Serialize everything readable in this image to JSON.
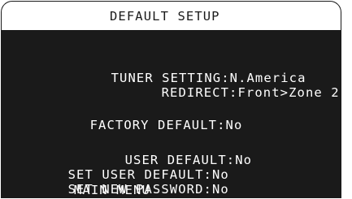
{
  "title": "DEFAULT SETUP",
  "rows": [
    {
      "label": "TUNER SETTING:",
      "value": "N.America"
    },
    {
      "label": "REDIRECT:",
      "value": "Front>Zone 2"
    },
    {
      "label": "FACTORY DEFAULT:",
      "value": "No"
    },
    {
      "label": "USER DEFAULT:",
      "value": "No"
    },
    {
      "label": "SET USER DEFAULT:",
      "value": "No"
    },
    {
      "label": "SET NEW PASSWORD:",
      "value": "No"
    }
  ],
  "main_menu": "MAIN MENU",
  "colors": {
    "background": "#1a1a1a",
    "text": "#ffffff",
    "title_bar": "#ffffff"
  }
}
